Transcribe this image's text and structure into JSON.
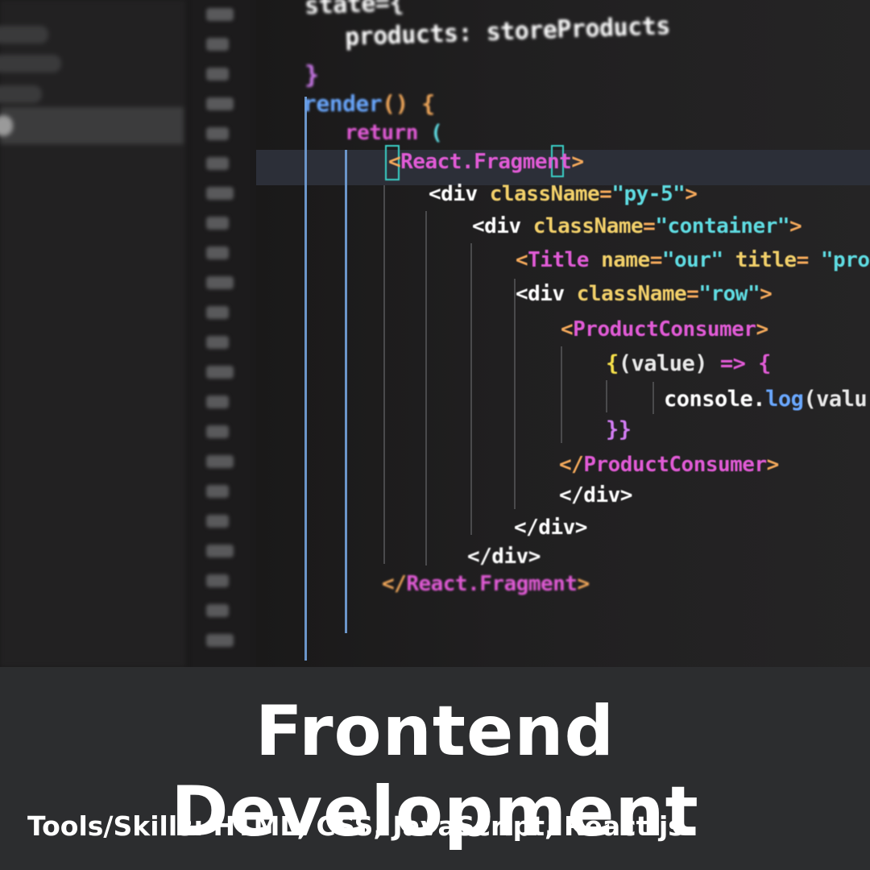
{
  "banner": {
    "title": "Frontend Development",
    "subtitle": "Tools/Skills: HTML, CSS, JavaScript, React.js"
  },
  "code_lines": [
    {
      "tokens": [
        [
          "state={",
          "c-white"
        ]
      ]
    },
    {
      "tokens": [
        [
          "products: storeProducts",
          "c-white"
        ]
      ]
    },
    {
      "tokens": [
        [
          "}",
          "c-purple"
        ]
      ]
    },
    {
      "tokens": [
        [
          "render",
          "c-blue"
        ],
        [
          "() {",
          "c-orange"
        ]
      ]
    },
    {
      "tokens": [
        [
          "return",
          "c-pink"
        ],
        [
          " (",
          "c-cyan"
        ]
      ]
    },
    {
      "tokens": [
        [
          "<",
          "c-orange"
        ],
        [
          "React.Fragment",
          "c-pink"
        ],
        [
          ">",
          "c-orange"
        ]
      ]
    },
    {
      "tokens": [
        [
          "<div ",
          "c-white"
        ],
        [
          "className",
          "c-yellow"
        ],
        [
          "=",
          "c-orange"
        ],
        [
          "\"py-5\"",
          "c-cyan"
        ],
        [
          ">",
          "c-orange"
        ]
      ]
    },
    {
      "tokens": [
        [
          "<div ",
          "c-white"
        ],
        [
          "className",
          "c-yellow"
        ],
        [
          "=",
          "c-orange"
        ],
        [
          "\"container\"",
          "c-cyan"
        ],
        [
          ">",
          "c-orange"
        ]
      ]
    },
    {
      "tokens": [
        [
          "<",
          "c-orange"
        ],
        [
          "Title",
          "c-pink"
        ],
        [
          " name",
          "c-yellow"
        ],
        [
          "=",
          "c-orange"
        ],
        [
          "\"our\"",
          "c-cyan"
        ],
        [
          " title",
          "c-yellow"
        ],
        [
          "=",
          "c-orange"
        ],
        [
          " \"prod",
          "c-cyan"
        ]
      ]
    },
    {
      "tokens": [
        [
          "<div ",
          "c-white"
        ],
        [
          "className",
          "c-yellow"
        ],
        [
          "=",
          "c-orange"
        ],
        [
          "\"row\"",
          "c-cyan"
        ],
        [
          ">",
          "c-orange"
        ]
      ]
    },
    {
      "tokens": [
        [
          "<",
          "c-orange"
        ],
        [
          "ProductConsumer",
          "c-pink"
        ],
        [
          ">",
          "c-orange"
        ]
      ]
    },
    {
      "tokens": [
        [
          "{",
          "c-brace"
        ],
        [
          "(value) ",
          "c-light"
        ],
        [
          "=>",
          "c-pink"
        ],
        [
          " {",
          "c-pink"
        ]
      ]
    },
    {
      "tokens": [
        [
          "console",
          "c-white"
        ],
        [
          ".",
          "c-white"
        ],
        [
          "log",
          "c-blue"
        ],
        [
          "(valu",
          "c-light"
        ]
      ]
    },
    {
      "tokens": [
        [
          "}}",
          "c-purple"
        ]
      ]
    },
    {
      "tokens": [
        [
          "</",
          "c-orange"
        ],
        [
          "ProductConsumer",
          "c-pink"
        ],
        [
          ">",
          "c-orange"
        ]
      ]
    },
    {
      "tokens": [
        [
          "</div>",
          "c-white"
        ]
      ]
    },
    {
      "tokens": [
        [
          "</div>",
          "c-white"
        ]
      ]
    },
    {
      "tokens": [
        [
          "</div>",
          "c-white"
        ]
      ]
    },
    {
      "tokens": [
        [
          "</",
          "c-orange"
        ],
        [
          "React.Fragment",
          "c-pink"
        ],
        [
          ">",
          "c-orange"
        ]
      ]
    }
  ]
}
